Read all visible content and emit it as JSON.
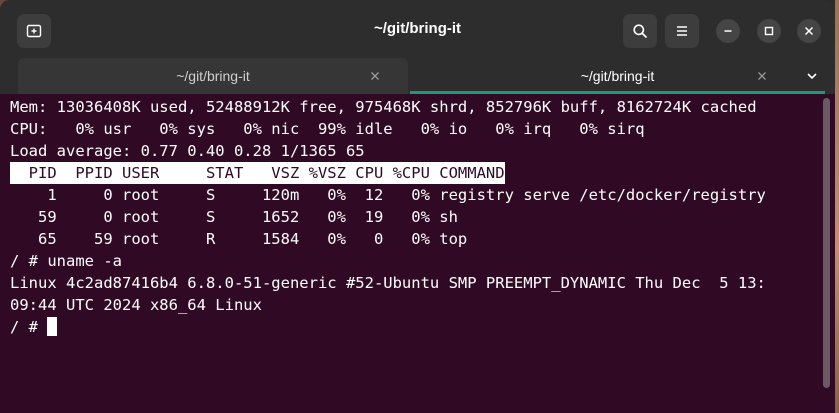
{
  "window": {
    "title": "~/git/bring-it"
  },
  "header_buttons": {
    "new_tab_icon": "new-tab-icon",
    "search_icon": "search-icon",
    "menu_icon": "hamburger-menu-icon",
    "minimize_icon": "minimize-icon",
    "maximize_icon": "maximize-icon",
    "close_icon": "close-icon"
  },
  "tabs": [
    {
      "label": "~/git/bring-it",
      "active": false
    },
    {
      "label": "~/git/bring-it",
      "active": true
    }
  ],
  "terminal": {
    "lines": [
      "Mem: 13036408K used, 52488912K free, 975468K shrd, 852796K buff, 8162724K cached",
      "CPU:   0% usr   0% sys   0% nic  99% idle   0% io   0% irq   0% sirq",
      "Load average: 0.77 0.40 0.28 1/1365 65",
      "  PID  PPID USER     STAT   VSZ %VSZ CPU %CPU COMMAND",
      "    1     0 root     S     120m   0%  12   0% registry serve /etc/docker/registry",
      "   59     0 root     S     1652   0%  19   0% sh",
      "   65    59 root     R     1584   0%   0   0% top",
      "/ # uname -a",
      "Linux 4c2ad87416b4 6.8.0-51-generic #52-Ubuntu SMP PREEMPT_DYNAMIC Thu Dec  5 13:",
      "09:44 UTC 2024 x86_64 Linux",
      "/ # "
    ]
  },
  "colors": {
    "terminal_bg": "#300a24",
    "header_bg": "#2d2d2d",
    "tab_indicator": "#1a9a7a"
  }
}
